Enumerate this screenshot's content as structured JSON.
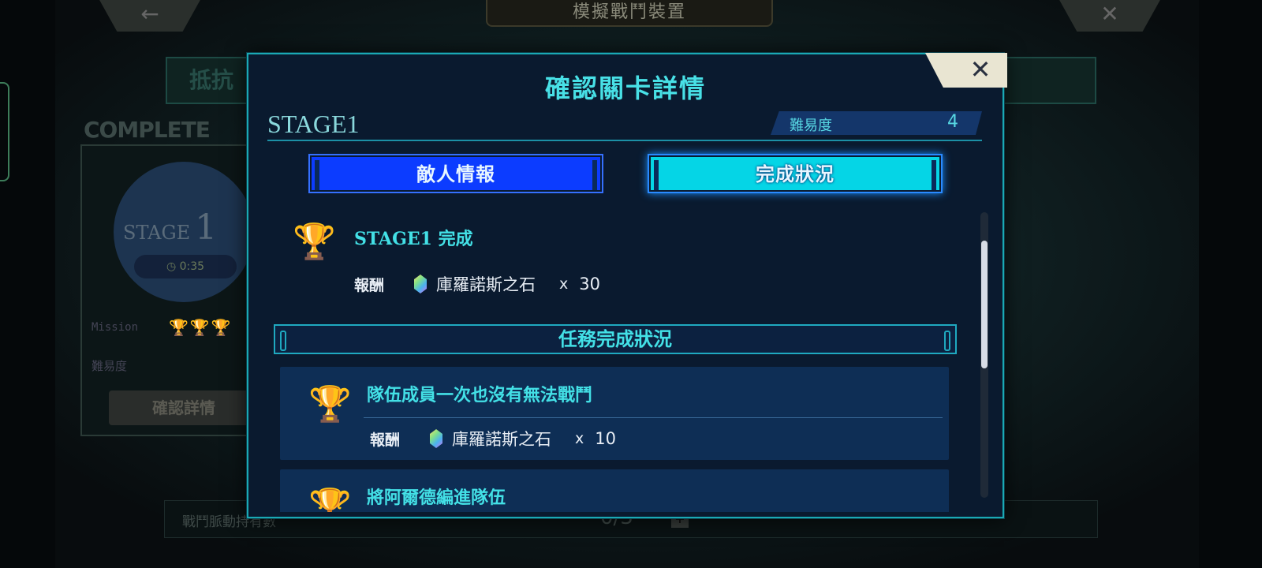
{
  "background": {
    "top_title": "模擬戰鬥裝置",
    "back_glyph": "←",
    "close_glyph": "✕",
    "banner": "抵抗",
    "complete_label": "COMPLETE",
    "card": {
      "stage_word": "STAGE",
      "stage_number": "1",
      "time": "0:35",
      "mission_label": "Mission",
      "difficulty_label": "難易度",
      "confirm_button": "確認詳情"
    },
    "bottom_label": "戰鬥脈動持有數",
    "bottom_count": "0/3",
    "bottom_plus": "+"
  },
  "modal": {
    "title": "確認關卡詳情",
    "close_glyph": "✕",
    "stage": "STAGE1",
    "difficulty_label": "難易度",
    "difficulty_value": "4",
    "tabs": {
      "enemy": "敵人情報",
      "completion": "完成狀況"
    },
    "stage_complete": {
      "title": "STAGE1 完成",
      "reward_label": "報酬",
      "reward_item": "庫羅諾斯之石",
      "reward_x": "x",
      "reward_qty": "30"
    },
    "section_title": "任務完成狀況",
    "missions": [
      {
        "title": "隊伍成員一次也沒有無法戰鬥",
        "reward_label": "報酬",
        "reward_item": "庫羅諾斯之石",
        "reward_x": "x",
        "reward_qty": "10"
      },
      {
        "title": "將阿爾德編進隊伍"
      }
    ]
  },
  "colors": {
    "accent_cyan": "#43e0e6",
    "tab_active": "#05d5e6",
    "tab_inactive": "#0c3cff",
    "modal_bg": "#0a1a2f"
  }
}
